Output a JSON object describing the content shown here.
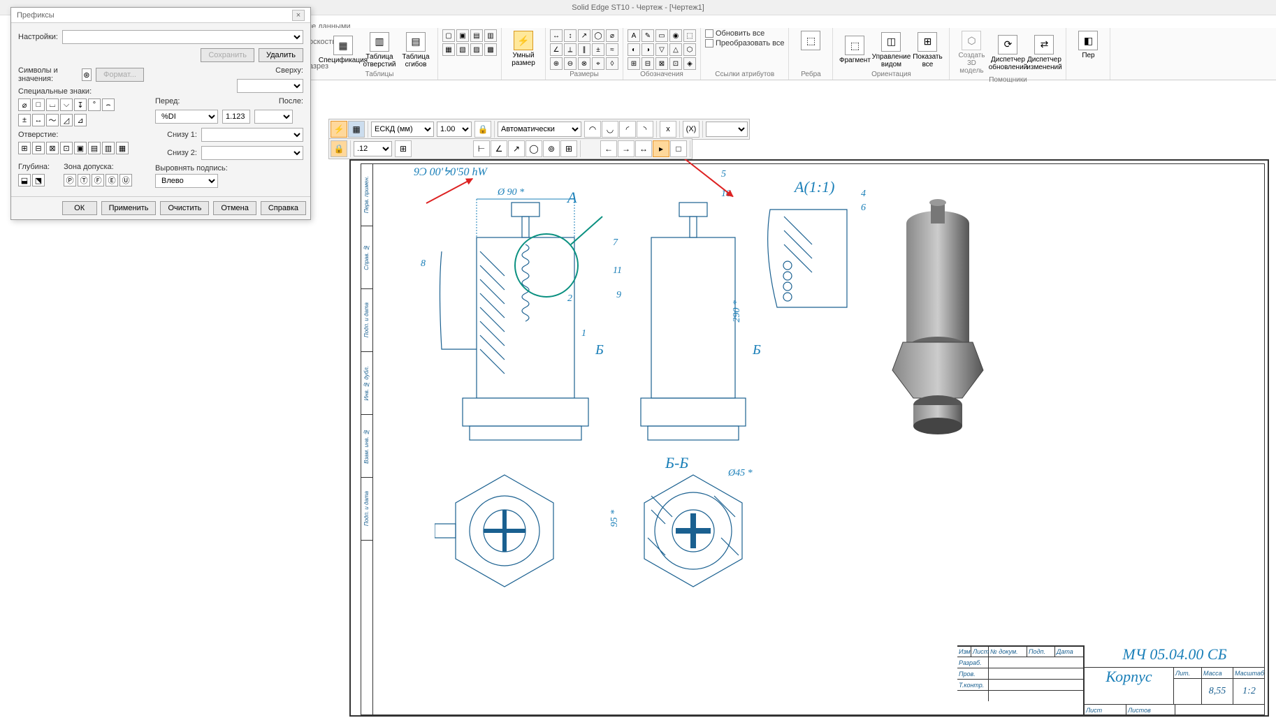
{
  "app": {
    "title": "Solid Edge ST10 - Чертеж - [Чертеж1]"
  },
  "ribbon_hints": {
    "data": "не данными",
    "plane": "оскость",
    "cut": "азрез"
  },
  "ribbon": {
    "groups": {
      "tables": {
        "label": "Таблицы",
        "spec": "Спецификация",
        "holes": "Таблица отверстий",
        "bends": "Таблица сгибов"
      },
      "smart": {
        "label": "Умный размер"
      },
      "dims": {
        "label": "Размеры"
      },
      "annot": {
        "label": "Обозначения"
      },
      "attrs": {
        "label": "Ссылки атрибутов",
        "update": "Обновить все",
        "convert": "Преобразовать все"
      },
      "edges": {
        "label": "Ребра"
      },
      "orient": {
        "label": "Ориентация",
        "frag": "Фрагмент",
        "manage": "Управление видом",
        "show": "Показать все"
      },
      "helpers": {
        "label": "Помощники",
        "create3d": "Создать 3D модель",
        "updmgr": "Диспетчер обновлений",
        "chgmgr": "Диспетчер изменений"
      },
      "last": {
        "label": "Пер"
      }
    }
  },
  "dialog": {
    "title": "Префиксы",
    "settings_label": "Настройки:",
    "save": "Сохранить",
    "delete": "Удалить",
    "symbols_label": "Символы и значения:",
    "format": "Формат...",
    "special_label": "Специальные знаки:",
    "hole_label": "Отверстие:",
    "depth_label": "Глубина:",
    "zone_label": "Зона допуска:",
    "top_label": "Сверху:",
    "before_label": "Перед:",
    "after_label": "После:",
    "below1_label": "Снизу 1:",
    "below2_label": "Снизу 2:",
    "align_label": "Выровнять подпись:",
    "before_value": "%DI",
    "superscript_value": "1.123",
    "align_value": "Влево",
    "ok": "ОК",
    "apply": "Применить",
    "clear": "Очистить",
    "cancel": "Отмена",
    "help": "Справка"
  },
  "toolbar": {
    "standard": "ЕСКД (мм)",
    "scale": "1.00",
    "auto": "Автоматически",
    "layer": ".12",
    "x_sym": "x",
    "xcirc_sym": "(X)"
  },
  "drawing": {
    "detail_label": "А(1:1)",
    "section_a": "А",
    "section_b": "Б",
    "section_bb": "Б-Б",
    "dim_90": "Ø 90 *",
    "dim_45": "Ø45 *",
    "dim_95": "95 *",
    "dim_290": "290 *",
    "dim_5": "5",
    "dim_10": "10",
    "callouts": {
      "c1": "1",
      "c2": "2",
      "c4": "4",
      "c6": "6",
      "c7": "7",
      "c8": "8",
      "c9": "9",
      "c11": "11"
    },
    "top_mirror": "9Ɔ 00'ᔭ0'50 hW"
  },
  "titleblock": {
    "number": "МЧ 05.04.00 СБ",
    "name": "Корпус",
    "mass": "8,55",
    "scale": "1:2",
    "hdr_izm": "Изм",
    "hdr_list": "Лист",
    "hdr_doc": "№ докум.",
    "hdr_sign": "Подп.",
    "hdr_date": "Дата",
    "hdr_lit": "Лит.",
    "hdr_mass": "Масса",
    "hdr_scale": "Масштаб",
    "row_dev": "Разраб.",
    "row_chk": "Пров.",
    "row_tcon": "Т.контр.",
    "ft_list": "Лист",
    "ft_lists": "Листов"
  },
  "sidestrip": {
    "s1": "Перв. примен.",
    "s2": "Справ. №",
    "s3": "Подп. и дата",
    "s4": "Инв. № дубл.",
    "s5": "Взам. инв. №",
    "s6": "Подп. и дата"
  }
}
